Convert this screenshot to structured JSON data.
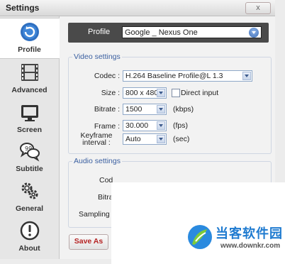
{
  "window": {
    "title": "Settings",
    "close_glyph": "x"
  },
  "sidebar": {
    "items": [
      {
        "label": "Profile",
        "icon": "profile-icon",
        "active": true
      },
      {
        "label": "Advanced",
        "icon": "film-icon"
      },
      {
        "label": "Screen",
        "icon": "monitor-icon"
      },
      {
        "label": "Subtitle",
        "icon": "speech-bubbles-icon"
      },
      {
        "label": "General",
        "icon": "gears-icon"
      },
      {
        "label": "About",
        "icon": "info-icon"
      }
    ]
  },
  "profile": {
    "label": "Profile",
    "value": "Google _ Nexus One"
  },
  "video_settings": {
    "title": "Video settings",
    "codec": {
      "label": "Codec :",
      "value": "H.264 Baseline Profile@L 1.3"
    },
    "size": {
      "label": "Size :",
      "value": "800 x 480",
      "direct_input_label": "Direct input"
    },
    "bitrate": {
      "label": "Bitrate :",
      "value": "1500",
      "unit": "(kbps)"
    },
    "frame": {
      "label": "Frame :",
      "value": "30.000",
      "unit": "(fps)"
    },
    "keyframe": {
      "label_line1": "Keyframe",
      "label_line2": "interval :",
      "value": "Auto",
      "unit": "(sec)"
    }
  },
  "audio_settings": {
    "title": "Audio settings",
    "codec_label": "Cod",
    "bitrate_label": "Bitra",
    "sampling_label": "Sampling ra"
  },
  "buttons": {
    "save_as": "Save As"
  },
  "watermark": {
    "chinese": "当客软件园",
    "url": "www.downkr.com"
  },
  "colors": {
    "accent": "#3a5fa0",
    "save_text": "#b52323",
    "logo_blue": "#1f7bd0"
  }
}
